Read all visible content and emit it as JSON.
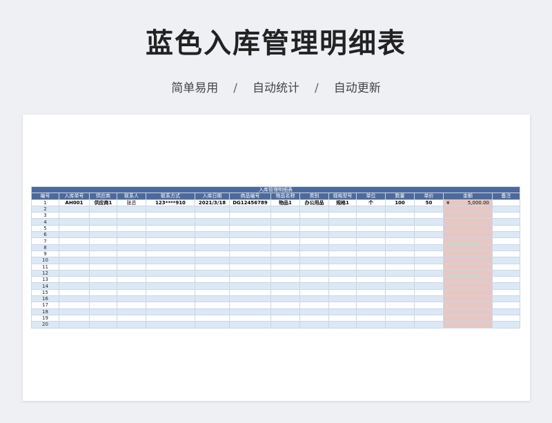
{
  "title": "蓝色入库管理明细表",
  "subtitle": [
    "简单易用",
    "自动统计",
    "自动更新"
  ],
  "subtitle_sep": "/",
  "sheet": {
    "title": "入库管理明细表",
    "headers": [
      "编号",
      "入库单号",
      "供应商",
      "联系人",
      "联系方式",
      "入库日期",
      "商品编号",
      "物品名称",
      "类别",
      "规格型号",
      "单位",
      "数量",
      "单价",
      "金额",
      "备注"
    ],
    "rows": [
      {
        "no": "1",
        "order": "AH001",
        "supplier": "供应商1",
        "contact": "张总",
        "phone": "123****910",
        "date": "2021/3/18",
        "code": "DG12456789",
        "name": "物品1",
        "category": "办公用品",
        "spec": "规格1",
        "unit": "个",
        "qty": "100",
        "price": "50",
        "currency": "¥",
        "amount": "5,000.00",
        "note": ""
      },
      {
        "no": "2"
      },
      {
        "no": "3"
      },
      {
        "no": "4"
      },
      {
        "no": "5"
      },
      {
        "no": "6"
      },
      {
        "no": "7"
      },
      {
        "no": "8"
      },
      {
        "no": "9"
      },
      {
        "no": "10"
      },
      {
        "no": "11"
      },
      {
        "no": "12"
      },
      {
        "no": "13"
      },
      {
        "no": "14"
      },
      {
        "no": "15"
      },
      {
        "no": "16"
      },
      {
        "no": "17"
      },
      {
        "no": "18"
      },
      {
        "no": "19"
      },
      {
        "no": "20"
      }
    ]
  },
  "colors": {
    "header_bg": "#4e6a9c",
    "stripe": "#dde8f5",
    "amount_bg": "#e7c7c3"
  }
}
